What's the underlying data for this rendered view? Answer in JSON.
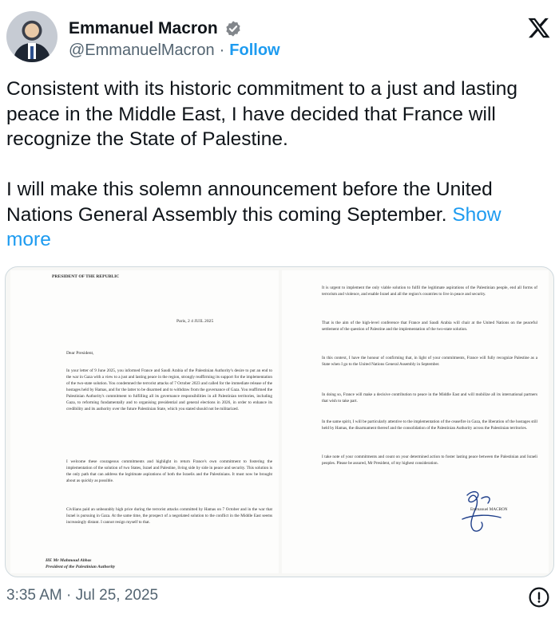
{
  "author": {
    "name": "Emmanuel Macron",
    "handle": "@EmmanuelMacron",
    "separator": "·",
    "follow_label": "Follow"
  },
  "icons": {
    "verified": "verified-badge-icon",
    "logo": "x-logo-icon",
    "share": "share-icon"
  },
  "colors": {
    "accent": "#1d9bf0",
    "text": "#0f1419",
    "secondary": "#536471"
  },
  "tweet": {
    "text": "Consistent with its historic commitment to a just and lasting peace in the Middle East, I have decided that France will recognize the State of Palestine.\n\nI will make this solemn announcement before the United Nations General Assembly this coming September. ",
    "show_more_label": "Show more"
  },
  "letter": {
    "header": "PRESIDENT OF THE REPUBLIC",
    "date": "Paris, 2 4 JUIL 2025",
    "salutation": "Dear President,",
    "left_paragraphs": [
      "In your letter of 9 June 2025, you informed France and Saudi Arabia of the Palestinian Authority's desire to put an end to the war in Gaza with a view to a just and lasting peace in the region, strongly reaffirming its support for the implementation of the two-state solution. You condemned the terrorist attacks of 7 October 2023 and called for the immediate release of the hostages held by Hamas, and for the latter to be disarmed and to withdraw from the governance of Gaza. You reaffirmed the Palestinian Authority's commitment to fulfilling all its governance responsibilities in all Palestinian territories, including Gaza, to reforming fundamentally and to organising presidential and general elections in 2026, in order to enhance its credibility and its authority over the future Palestinian State, which you stated should not be militarized.",
      "I welcome these courageous commitments and highlight in return France's own commitment to fostering the implementation of the solution of two States, Israel and Palestine, living side by side in peace and security. This solution is the only path that can address the legitimate aspirations of both the Israelis and the Palestinians. It must now be brought about as quickly as possible.",
      "Civilians paid an unbearably high price during the terrorist attacks committed by Hamas on 7 October and in the war that Israel is pursuing in Gaza. At the same time, the prospect of a negotiated solution to the conflict in the Middle East seems increasingly distant. I cannot resign myself to that."
    ],
    "addressee_line1": "HE Mr Mahmoud Abbas",
    "addressee_line2": "President of the Palestinian Authority",
    "right_paragraphs": [
      "It is urgent to implement the only viable solution to fulfil the legitimate aspirations of the Palestinian people, end all forms of terrorism and violence, and enable Israel and all the region's countries to live in peace and security.",
      "That is the aim of the high-level conference that France and Saudi Arabia will chair at the United Nations on the peaceful settlement of the question of Palestine and the implementation of the two-state solution.",
      "In this context, I have the honour of confirming that, in light of your commitments, France will fully recognize Palestine as a State when I go to the United Nations General Assembly in September.",
      "In doing so, France will make a decisive contribution to peace in the Middle East and will mobilize all its international partners that wish to take part.",
      "In the same spirit, I will be particularly attentive to the implementation of the ceasefire in Gaza, the liberation of the hostages still held by Hamas, the disarmament thereof and the consolidation of the Palestinian Authority across the Palestinian territories.",
      "I take note of your commitments and count on your determined action to foster lasting peace between the Palestinian and Israeli peoples. Please be assured, Mr President, of my highest consideration."
    ],
    "signatory": "Emmanuel MACRON"
  },
  "footer": {
    "timestamp": "3:35 AM · Jul 25, 2025"
  }
}
